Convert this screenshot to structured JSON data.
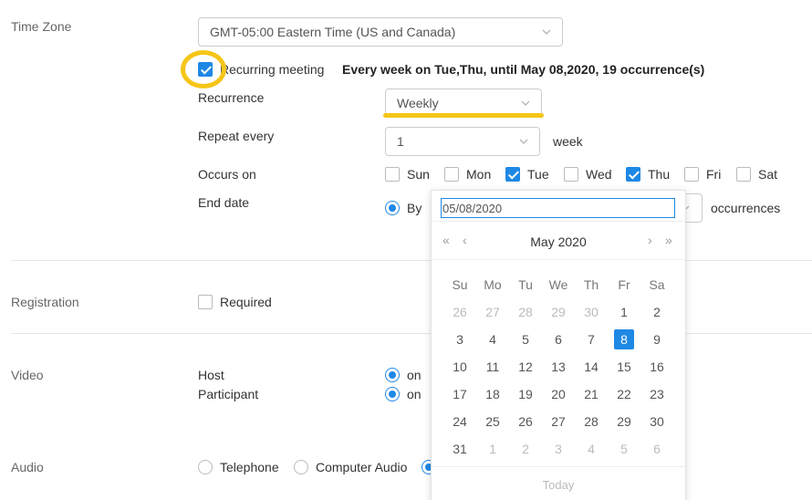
{
  "time_zone": {
    "label": "Time Zone",
    "value": "GMT-05:00 Eastern Time (US and Canada)"
  },
  "recurring": {
    "label": "Recurring meeting",
    "checked": true,
    "summary": "Every week on Tue,Thu, until May 08,2020, 19 occurrence(s)"
  },
  "recurrence": {
    "label": "Recurrence",
    "value": "Weekly"
  },
  "repeat_every": {
    "label": "Repeat every",
    "value": "1",
    "unit": "week"
  },
  "occurs_on": {
    "label": "Occurs on",
    "days": [
      {
        "label": "Sun",
        "checked": false
      },
      {
        "label": "Mon",
        "checked": false
      },
      {
        "label": "Tue",
        "checked": true
      },
      {
        "label": "Wed",
        "checked": false
      },
      {
        "label": "Thu",
        "checked": true
      },
      {
        "label": "Fri",
        "checked": false
      },
      {
        "label": "Sat",
        "checked": false
      }
    ]
  },
  "end_date": {
    "label": "End date",
    "by_label": "By",
    "date_value": "05/08/2020",
    "occurrences_label": "occurrences"
  },
  "calendar": {
    "title": "May 2020",
    "prev_year": "«",
    "prev_month": "‹",
    "next_month": "›",
    "next_year": "»",
    "weekdays": [
      "Su",
      "Mo",
      "Tu",
      "We",
      "Th",
      "Fr",
      "Sa"
    ],
    "weeks": [
      [
        "26",
        "27",
        "28",
        "29",
        "30",
        "1",
        "2"
      ],
      [
        "3",
        "4",
        "5",
        "6",
        "7",
        "8",
        "9"
      ],
      [
        "10",
        "11",
        "12",
        "13",
        "14",
        "15",
        "16"
      ],
      [
        "17",
        "18",
        "19",
        "20",
        "21",
        "22",
        "23"
      ],
      [
        "24",
        "25",
        "26",
        "27",
        "28",
        "29",
        "30"
      ],
      [
        "31",
        "1",
        "2",
        "3",
        "4",
        "5",
        "6"
      ]
    ],
    "selected": "8",
    "today_label": "Today"
  },
  "registration": {
    "label": "Registration",
    "required_label": "Required"
  },
  "video": {
    "label": "Video",
    "host_label": "Host",
    "participant_label": "Participant",
    "on_label": "on"
  },
  "audio": {
    "label": "Audio",
    "telephone_label": "Telephone",
    "computer_audio_label": "Computer Audio"
  },
  "colors": {
    "accent": "#1e88e5",
    "highlight": "#f5c518"
  }
}
